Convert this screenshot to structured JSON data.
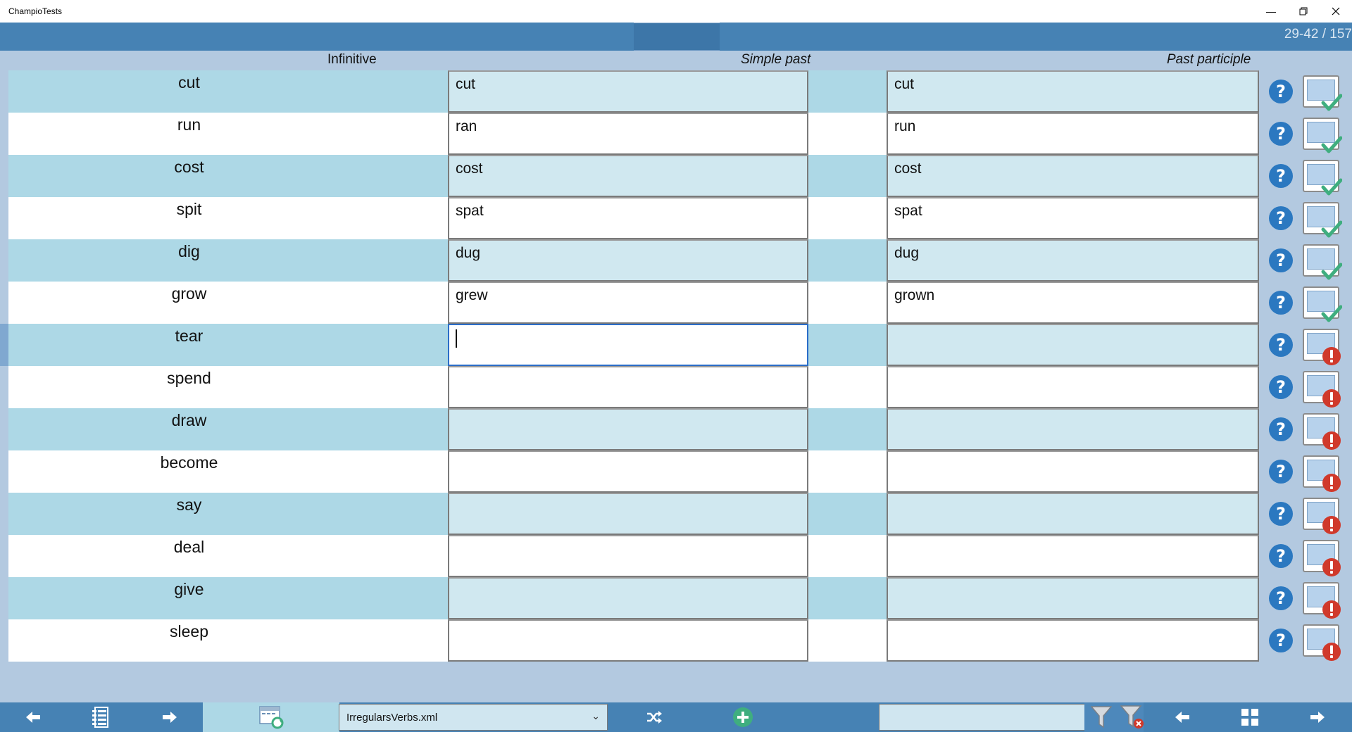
{
  "window": {
    "title": "ChampioTests",
    "minimize_icon": "minimize-icon",
    "restore_icon": "restore-icon",
    "close_icon": "close-icon"
  },
  "header": {
    "counter": "29-42 / 157"
  },
  "columns": {
    "infinitive": "Infinitive",
    "simple_past": "Simple past",
    "past_participle": "Past participle"
  },
  "rows": [
    {
      "infinitive": "cut",
      "simple_past": "cut",
      "past_participle": "cut",
      "status": "correct"
    },
    {
      "infinitive": "run",
      "simple_past": "ran",
      "past_participle": "run",
      "status": "correct"
    },
    {
      "infinitive": "cost",
      "simple_past": "cost",
      "past_participle": "cost",
      "status": "correct"
    },
    {
      "infinitive": "spit",
      "simple_past": "spat",
      "past_participle": "spat",
      "status": "correct"
    },
    {
      "infinitive": "dig",
      "simple_past": "dug",
      "past_participle": "dug",
      "status": "correct"
    },
    {
      "infinitive": "grow",
      "simple_past": "grew",
      "past_participle": "grown",
      "status": "correct"
    },
    {
      "infinitive": "tear",
      "simple_past": "",
      "past_participle": "",
      "status": "error"
    },
    {
      "infinitive": "spend",
      "simple_past": "",
      "past_participle": "",
      "status": "error"
    },
    {
      "infinitive": "draw",
      "simple_past": "",
      "past_participle": "",
      "status": "error"
    },
    {
      "infinitive": "become",
      "simple_past": "",
      "past_participle": "",
      "status": "error"
    },
    {
      "infinitive": "say",
      "simple_past": "",
      "past_participle": "",
      "status": "error"
    },
    {
      "infinitive": "deal",
      "simple_past": "",
      "past_participle": "",
      "status": "error"
    },
    {
      "infinitive": "give",
      "simple_past": "",
      "past_participle": "",
      "status": "error"
    },
    {
      "infinitive": "sleep",
      "simple_past": "",
      "past_participle": "",
      "status": "error"
    }
  ],
  "bottombar": {
    "file_name": "IrregularsVerbs.xml",
    "search_value": "",
    "icons": [
      "arrow-left-icon",
      "list-icon",
      "arrow-right-icon",
      "window-refresh-icon",
      "shuffle-icon",
      "add-icon",
      "filter-icon",
      "clear-filter-icon",
      "page-previous-icon",
      "grid-icon",
      "page-next-icon"
    ]
  },
  "colors": {
    "accent": "#4682b4",
    "row_alt": "#add8e6",
    "correct": "#3fae7f",
    "error": "#d0392b",
    "help": "#2b78c0"
  }
}
